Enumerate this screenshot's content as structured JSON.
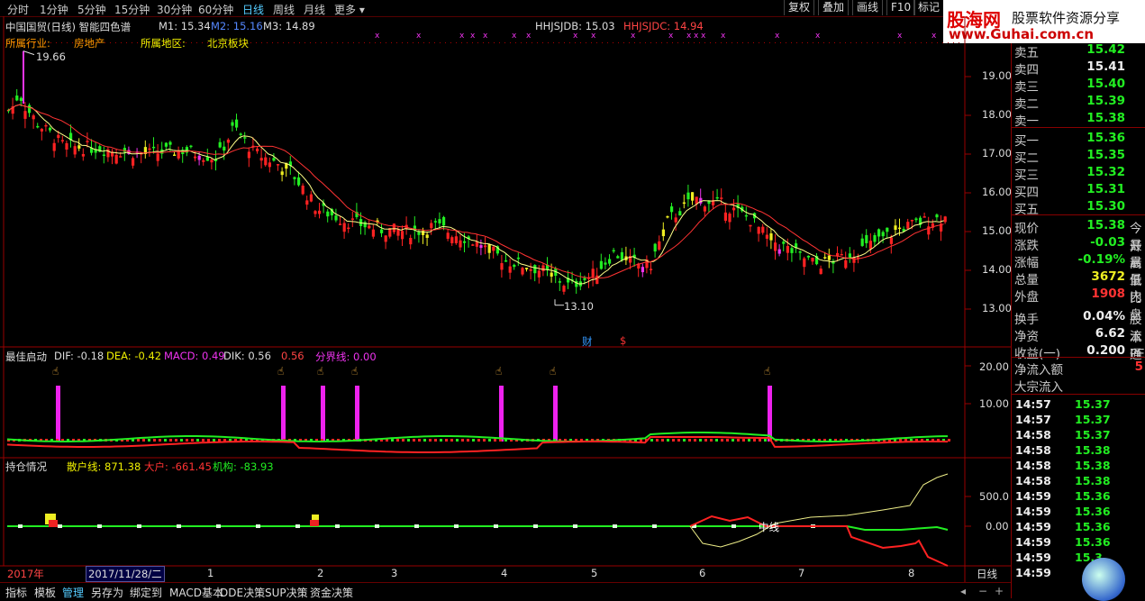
{
  "toolbar": {
    "tabs": [
      "分时",
      "1分钟",
      "5分钟",
      "15分钟",
      "30分钟",
      "60分钟",
      "日线",
      "周线",
      "月线",
      "更多"
    ],
    "active_tab": "日线",
    "right_buttons": [
      "复权",
      "叠加",
      "画线",
      "F10",
      "标记"
    ]
  },
  "logo": {
    "brand": "股海网",
    "tagline": "股票软件资源分享",
    "url": "www.Guhai.com.cn"
  },
  "main_chart": {
    "title": "中国国贸(日线) 智能四色谱",
    "m1": "M1: 15.34",
    "m2": "M2: 15.16",
    "m3": "M3: 14.89",
    "hhjsjdb": "HHJSJDB: 15.03",
    "hhjsjdc": "HHJSJDC: 14.94",
    "industry_label": "所属行业:",
    "industry": "房地产",
    "region_label": "所属地区:",
    "region": "北京板块",
    "high_marker": "19.66",
    "low_marker": "13.10",
    "price_ticks": [
      "19.00",
      "18.00",
      "17.00",
      "16.00",
      "15.00",
      "14.00",
      "13.00"
    ],
    "event_cai": "财",
    "event_s": "$"
  },
  "macd_panel": {
    "title": "最佳启动",
    "dif": "DIF: -0.18",
    "dea": "DEA: -0.42",
    "macd": "MACD: 0.49",
    "dik": "DIK: 0.56",
    "v56": "0.56",
    "fenjie": "分界线: 0.00",
    "ticks": [
      "20.00",
      "10.00"
    ]
  },
  "position_panel": {
    "title": "持仓情况",
    "sanhu": "散户线: 871.38",
    "dahu": "大户: -661.45",
    "jigou": "机构: -83.93",
    "ticks": [
      "500.0",
      "0.00"
    ],
    "midline": "中线"
  },
  "time_axis": {
    "year": "2017年",
    "cursor_date": "2017/11/28/二",
    "months": [
      "1",
      "2",
      "3",
      "4",
      "5",
      "6",
      "7",
      "8"
    ],
    "period": "日线"
  },
  "quotes": {
    "asks": [
      {
        "name": "卖五",
        "price": "15.42"
      },
      {
        "name": "卖四",
        "price": "15.41"
      },
      {
        "name": "卖三",
        "price": "15.40"
      },
      {
        "name": "卖二",
        "price": "15.39"
      },
      {
        "name": "卖一",
        "price": "15.38"
      }
    ],
    "bids": [
      {
        "name": "买一",
        "price": "15.36"
      },
      {
        "name": "买二",
        "price": "15.35"
      },
      {
        "name": "买三",
        "price": "15.32"
      },
      {
        "name": "买四",
        "price": "15.31"
      },
      {
        "name": "买五",
        "price": "15.30"
      }
    ],
    "stats": [
      {
        "name": "现价",
        "value": "15.38",
        "extra": "今开",
        "color": "#2e2"
      },
      {
        "name": "涨跌",
        "value": "-0.03",
        "extra": "最高",
        "color": "#2e2"
      },
      {
        "name": "涨幅",
        "value": "-0.19%",
        "extra": "最低",
        "color": "#2e2"
      },
      {
        "name": "总量",
        "value": "3672",
        "extra": "量比",
        "color": "#ee2"
      },
      {
        "name": "外盘",
        "value": "1908",
        "extra": "内盘",
        "color": "#f33"
      },
      {
        "name": "换手",
        "value": "0.04%",
        "extra": "股本",
        "color": "#eee"
      },
      {
        "name": "净资",
        "value": "6.62",
        "extra": "流通",
        "color": "#eee"
      },
      {
        "name": "收益(一)",
        "value": "0.200",
        "extra": "PE(动",
        "color": "#eee"
      }
    ],
    "netflow_label": "净流入额",
    "netflow_value": "5",
    "block_label": "大宗流入",
    "ticks": [
      {
        "time": "14:57",
        "price": "15.37"
      },
      {
        "time": "14:57",
        "price": "15.37"
      },
      {
        "time": "14:58",
        "price": "15.37"
      },
      {
        "time": "14:58",
        "price": "15.38"
      },
      {
        "time": "14:58",
        "price": "15.38"
      },
      {
        "time": "14:58",
        "price": "15.38"
      },
      {
        "time": "14:59",
        "price": "15.36"
      },
      {
        "time": "14:59",
        "price": "15.36"
      },
      {
        "time": "14:59",
        "price": "15.36"
      },
      {
        "time": "14:59",
        "price": "15.36"
      },
      {
        "time": "14:59",
        "price": "15.3"
      },
      {
        "time": "14:59",
        "price": ""
      }
    ]
  },
  "bottom_tabs": [
    "指标",
    "模板",
    "管理",
    "另存为",
    "绑定到",
    "MACD基本",
    "DDE决策",
    "SUP决策",
    "资金决策"
  ],
  "bottom_active": "管理"
}
